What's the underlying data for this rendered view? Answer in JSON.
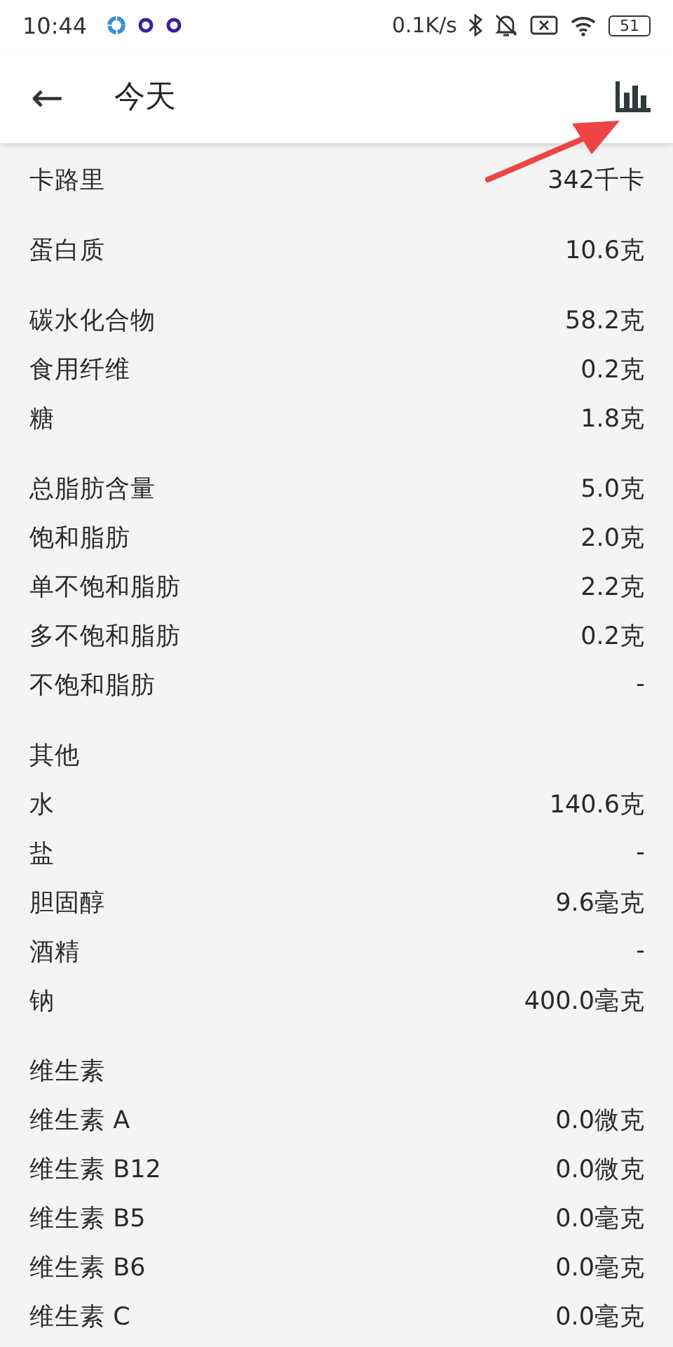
{
  "status_bar": {
    "time": "10:44",
    "speed": "0.1K/s",
    "battery": "51"
  },
  "app_bar": {
    "back": "←",
    "title": "今天"
  },
  "groups": [
    {
      "rows": [
        {
          "label": "卡路里",
          "value": "342千卡"
        }
      ]
    },
    {
      "rows": [
        {
          "label": "蛋白质",
          "value": "10.6克"
        }
      ]
    },
    {
      "rows": [
        {
          "label": "碳水化合物",
          "value": "58.2克"
        },
        {
          "label": "食用纤维",
          "value": "0.2克"
        },
        {
          "label": "糖",
          "value": "1.8克"
        }
      ]
    },
    {
      "rows": [
        {
          "label": "总脂肪含量",
          "value": "5.0克"
        },
        {
          "label": "饱和脂肪",
          "value": "2.0克"
        },
        {
          "label": "单不饱和脂肪",
          "value": "2.2克"
        },
        {
          "label": "多不饱和脂肪",
          "value": "0.2克"
        },
        {
          "label": "不饱和脂肪",
          "value": "-"
        }
      ]
    },
    {
      "title": "其他",
      "rows": [
        {
          "label": "水",
          "value": "140.6克"
        },
        {
          "label": "盐",
          "value": "-"
        },
        {
          "label": "胆固醇",
          "value": "9.6毫克"
        },
        {
          "label": "酒精",
          "value": "-"
        },
        {
          "label": "钠",
          "value": "400.0毫克"
        }
      ]
    },
    {
      "title": "维生素",
      "rows": [
        {
          "label": "维生素 A",
          "value": "0.0微克"
        },
        {
          "label": "维生素 B12",
          "value": "0.0微克"
        },
        {
          "label": "维生素 B5",
          "value": "0.0毫克"
        },
        {
          "label": "维生素 B6",
          "value": "0.0毫克"
        },
        {
          "label": "维生素 C",
          "value": "0.0毫克"
        }
      ]
    }
  ]
}
